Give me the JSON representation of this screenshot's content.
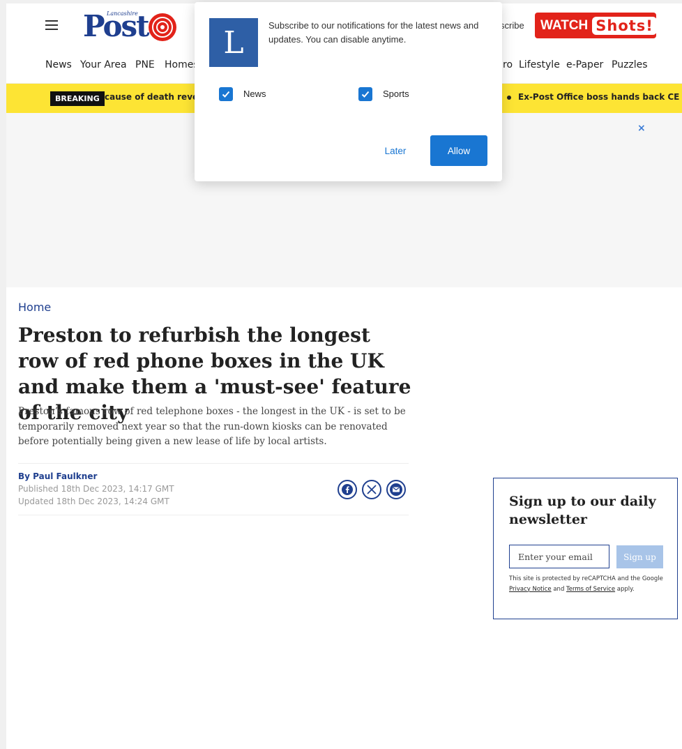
{
  "header": {
    "logo_small": "Lancashire",
    "logo_main": "Post",
    "subscribe_label": "scribe",
    "watch_label": "WATCH",
    "shots_label": "Shots!"
  },
  "nav": {
    "items": [
      "News",
      "Your Area",
      "PNE",
      "Homes",
      "ro",
      "Lifestyle",
      "e-Paper",
      "Puzzles"
    ]
  },
  "breaking": {
    "label": "BREAKING",
    "ticker_left": "cause of death reveale",
    "ticker_right": "Ex-Post Office boss hands back CE"
  },
  "ad": {
    "close": "×"
  },
  "article": {
    "breadcrumb": "Home",
    "headline": "Preston to refurbish the longest row of red phone boxes in the UK and make them a 'must-see' feature of the city",
    "standfirst": "Preston’s famous row of red telephone boxes - the longest in the UK - is set to be temporarily removed next year so that the run-down kiosks can be renovated before potentially being given a new lease of life by local artists.",
    "author": "By Paul Faulkner",
    "published": "Published 18th Dec 2023, 14:17 GMT",
    "updated": "Updated 18th Dec 2023, 14:24 GMT"
  },
  "newsletter": {
    "title": "Sign up to our daily newsletter",
    "placeholder": "Enter your email",
    "button": "Sign up",
    "legal_prefix": "This site is protected by reCAPTCHA and the Google ",
    "privacy": "Privacy Notice",
    "and": " and ",
    "terms": "Terms of Service",
    "apply": " apply."
  },
  "popup": {
    "logo_letter": "L",
    "message": "Subscribe to our notifications for the latest news and updates. You can disable anytime.",
    "option_news": "News",
    "option_sports": "Sports",
    "news_checked": true,
    "sports_checked": true,
    "later": "Later",
    "allow": "Allow"
  },
  "colors": {
    "brand_blue": "#1f3f8f",
    "breaking_yellow": "#fde434",
    "watch_red": "#e2231a",
    "popup_blue": "#1976d2"
  }
}
